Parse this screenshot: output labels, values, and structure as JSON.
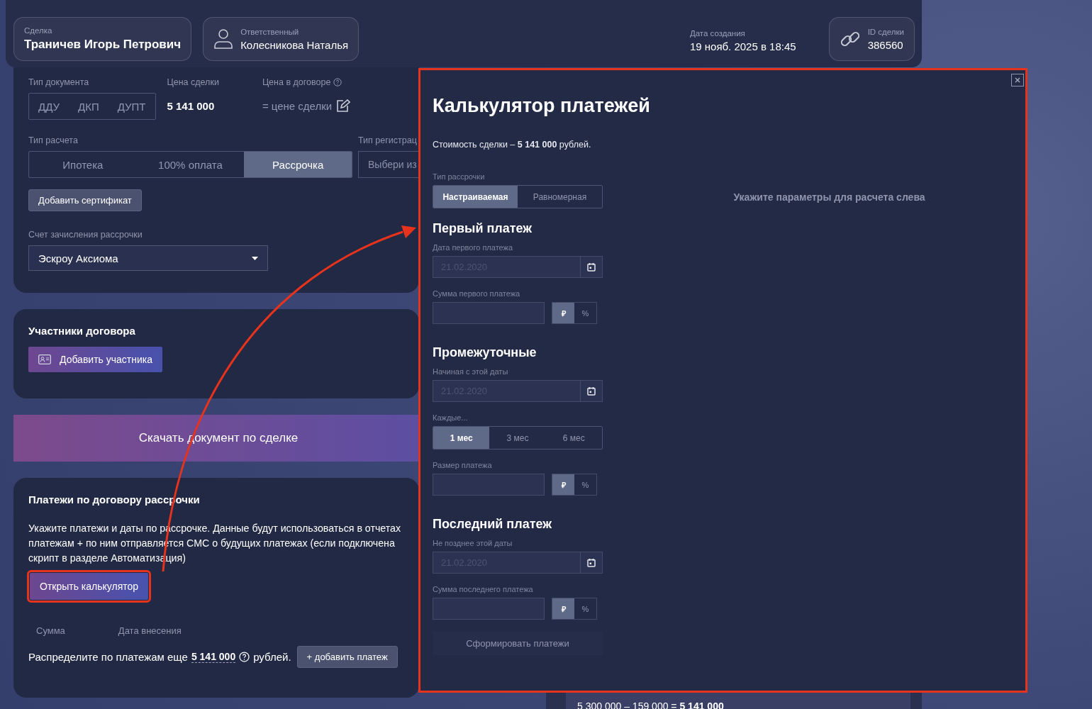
{
  "header": {
    "deal": {
      "label": "Сделка",
      "value": "Траничев Игорь Петрович"
    },
    "responsible": {
      "label": "Ответственный",
      "value": "Колесникова Наталья"
    },
    "created": {
      "label": "Дата создания",
      "value": "19 нояб. 2025 в 18:45"
    },
    "deal_id": {
      "label": "ID сделки",
      "value": "386560"
    }
  },
  "document_card": {
    "doc_type": {
      "label": "Тип документа",
      "options": [
        {
          "label": "ДДУ",
          "selected": false
        },
        {
          "label": "ДКП",
          "selected": false
        },
        {
          "label": "ДУПТ",
          "selected": false
        }
      ]
    },
    "deal_price": {
      "label": "Цена сделки",
      "value": "5 141 000"
    },
    "contract_price": {
      "label": "Цена в договоре",
      "value": "= цене сделки"
    },
    "payment_type": {
      "label": "Тип расчета",
      "options": [
        {
          "label": "Ипотека",
          "selected": false
        },
        {
          "label": "100% оплата",
          "selected": false
        },
        {
          "label": "Рассрочка",
          "selected": true
        }
      ]
    },
    "registration_type": {
      "label": "Тип регистрац",
      "placeholder": "Выбери из"
    },
    "add_certificate": "Добавить сертификат",
    "account": {
      "label": "Счет зачисления рассрочки",
      "value": "Эскроу Аксиома"
    }
  },
  "participants": {
    "title": "Участники договора",
    "add_button": "Добавить участника"
  },
  "download_button": "Скачать документ по сделке",
  "payments": {
    "title": "Платежи по договору рассрочки",
    "description_lines": [
      "Укажите платежи и даты по рассрочке. Данные будут использоваться в отчетах",
      "платежам + по ним отправляется СМС о будущих платежах (если подключена",
      "скрипт в разделе Автоматизация)"
    ],
    "open_calculator": "Открыть калькулятор",
    "columns": [
      "Сумма",
      "Дата внесения"
    ],
    "remaining_prefix": "Распределите по платежам еще",
    "remaining_amount": "5 141 000",
    "remaining_suffix": "рублей.",
    "add_payment": "+ добавить платеж"
  },
  "calculator": {
    "title": "Калькулятор платежей",
    "cost": "Стоимость сделки – **5 141 000** рублей.",
    "installment_type": {
      "label": "Тип рассрочки",
      "options": [
        {
          "label": "Настраиваемая",
          "selected": true
        },
        {
          "label": "Равномерная",
          "selected": false
        }
      ]
    },
    "sections": [
      {
        "title": "Первый платеж",
        "fields": [
          {
            "kind": "date",
            "label": "Дата первого платежа",
            "placeholder": "21.02.2020"
          },
          {
            "kind": "amount",
            "label": "Сумма первого платежа",
            "units": [
              {
                "label": "₽",
                "selected": true
              },
              {
                "label": "%",
                "selected": false
              }
            ]
          }
        ]
      },
      {
        "title": "Промежуточные",
        "fields": [
          {
            "kind": "date",
            "label": "Начиная с этой даты",
            "placeholder": "21.02.2020"
          },
          {
            "kind": "period",
            "label": "Каждые...",
            "options": [
              {
                "label": "1 мес",
                "selected": true
              },
              {
                "label": "3 мес",
                "selected": false
              },
              {
                "label": "6 мес",
                "selected": false
              }
            ]
          },
          {
            "kind": "amount",
            "label": "Размер платежа",
            "units": [
              {
                "label": "₽",
                "selected": true
              },
              {
                "label": "%",
                "selected": false
              }
            ]
          }
        ]
      },
      {
        "title": "Последний платеж",
        "fields": [
          {
            "kind": "date",
            "label": "Не позднее этой даты",
            "placeholder": "21.02.2020"
          },
          {
            "kind": "amount",
            "label": "Сумма последнего платежа",
            "units": [
              {
                "label": "₽",
                "selected": true
              },
              {
                "label": "%",
                "selected": false
              }
            ]
          }
        ]
      }
    ],
    "submit": "Сформировать платежи",
    "hint": "Укажите параметры для расчета слева"
  },
  "summary_panel": {
    "formula": "5 300 000 – 159 000 = **5 141 000**"
  }
}
